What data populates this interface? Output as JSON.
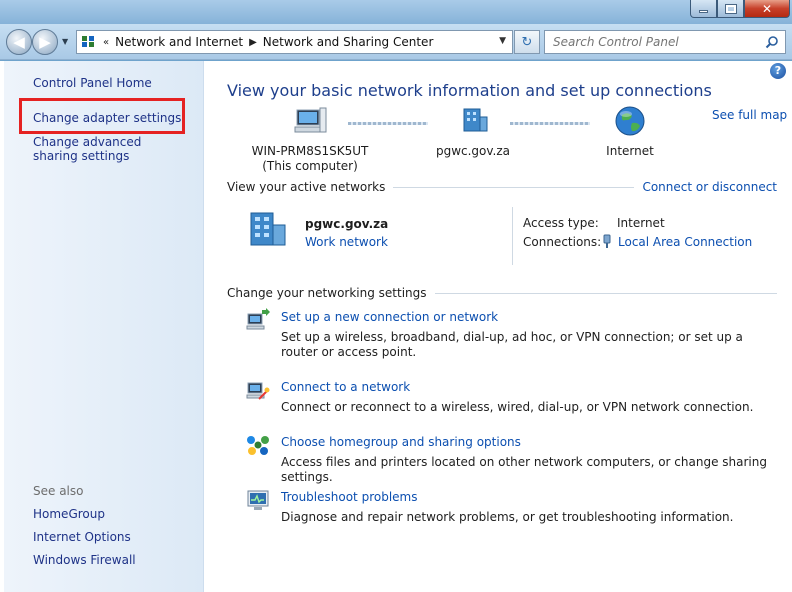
{
  "window": {
    "minimize_label": "",
    "close_label": "✕"
  },
  "nav": {
    "crumbs": [
      "Network and Internet",
      "Network and Sharing Center"
    ],
    "search_placeholder": "Search Control Panel"
  },
  "sidebar": {
    "items": [
      {
        "label": "Control Panel Home"
      },
      {
        "label": "Change adapter settings"
      },
      {
        "label": "Change advanced sharing settings"
      }
    ],
    "see_also_label": "See also",
    "see_also": [
      {
        "label": "HomeGroup"
      },
      {
        "label": "Internet Options"
      },
      {
        "label": "Windows Firewall"
      }
    ]
  },
  "main": {
    "title": "View your basic network information and set up connections",
    "see_full_map": "See full map",
    "map": {
      "computer_name": "WIN-PRM8S1SK5UT",
      "computer_sub": "(This computer)",
      "network_name": "pgwc.gov.za",
      "internet_label": "Internet"
    },
    "active_networks": {
      "heading": "View your active networks",
      "connect_link": "Connect or disconnect",
      "network_name": "pgwc.gov.za",
      "network_type": "Work network",
      "access_type_label": "Access type:",
      "access_type_value": "Internet",
      "connections_label": "Connections:",
      "connections_value": "Local Area Connection"
    },
    "settings": {
      "heading": "Change your networking settings",
      "tasks": [
        {
          "link": "Set up a new connection or network",
          "desc": "Set up a wireless, broadband, dial-up, ad hoc, or VPN connection; or set up a router or access point."
        },
        {
          "link": "Connect to a network",
          "desc": "Connect or reconnect to a wireless, wired, dial-up, or VPN network connection."
        },
        {
          "link": "Choose homegroup and sharing options",
          "desc": "Access files and printers located on other network computers, or change sharing settings."
        },
        {
          "link": "Troubleshoot problems",
          "desc": "Diagnose and repair network problems, or get troubleshooting information."
        }
      ]
    }
  }
}
